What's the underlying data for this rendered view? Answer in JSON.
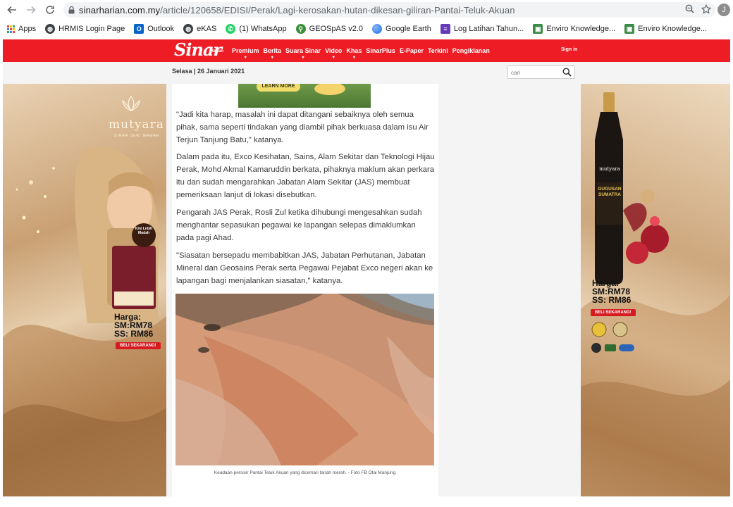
{
  "browser": {
    "url_host": "sinarharian.com.my",
    "url_path": "/article/120658/EDISI/Perak/Lagi-kerosakan-hutan-dikesan-giliran-Pantai-Teluk-Akuan",
    "profile_initial": "J"
  },
  "bookmarks": [
    {
      "label": "Apps",
      "icon": "apps-grid-icon"
    },
    {
      "label": "HRMIS Login Page",
      "icon": "globe-icon"
    },
    {
      "label": "Outlook",
      "icon": "outlook-icon"
    },
    {
      "label": "eKAS",
      "icon": "globe-icon"
    },
    {
      "label": "(1) WhatsApp",
      "icon": "whatsapp-icon"
    },
    {
      "label": "GEOSpAS v2.0",
      "icon": "geospas-icon"
    },
    {
      "label": "Google Earth",
      "icon": "google-earth-icon"
    },
    {
      "label": "Log Latihan Tahun...",
      "icon": "forms-icon"
    },
    {
      "label": "Enviro Knowledge...",
      "icon": "image-icon"
    },
    {
      "label": "Enviro Knowledge...",
      "icon": "image-icon"
    }
  ],
  "site": {
    "logo": "Sinar",
    "logo_sub": "Harian",
    "nav": [
      {
        "label": "Premium",
        "caret": true
      },
      {
        "label": "Berita",
        "caret": true
      },
      {
        "label": "Suara Sinar",
        "caret": true
      },
      {
        "label": "Video",
        "caret": true
      },
      {
        "label": "Khas",
        "caret": true
      },
      {
        "label": "SinarPlus",
        "caret": false
      },
      {
        "label": "E-Paper",
        "caret": false
      },
      {
        "label": "Terkini",
        "caret": false
      },
      {
        "label": "Pengiklanan",
        "caret": false
      }
    ],
    "sign_in": "Sign in",
    "date": "Selasa | 26 Januari 2021",
    "search_placeholder": "cari"
  },
  "ads": {
    "left": {
      "brand": "mutyara",
      "tagline": "SINAR SERI MAWAR",
      "badge": "Kini Lebih Mudah",
      "price_label": "Harga:",
      "price_sm": "SM:RM78",
      "price_ss": "SS: RM86",
      "cta": "BELI SEKARANG!"
    },
    "right": {
      "brand": "mutyara",
      "product": "GUGUSAN SUMATRA",
      "price_label": "Harga:",
      "price_sm": "SM:RM78",
      "price_ss": "SS: RM86",
      "cta": "BELI SEKARANG!"
    },
    "banner_cta": "LEARN MORE"
  },
  "article": {
    "paragraphs": [
      "\"Jadi kita harap, masalah ini dapat ditangani sebaiknya oleh semua pihak, sama seperti tindakan yang diambil pihak berkuasa dalam isu Air Terjun Tanjung Batu,\" katanya.",
      "Dalam pada itu, Exco Kesihatan, Sains, Alam Sekitar dan Teknologi Hijau Perak, Mohd Akmal Kamaruddin berkata, pihaknya maklum akan perkara itu dan sudah mengarahkan Jabatan Alam Sekitar (JAS) membuat pemeriksaan lanjut di lokasi disebutkan.",
      "Pengarah JAS Perak, Rosli Zul ketika dihubungi mengesahkan sudah menghantar sepasukan pegawai ke lapangan selepas dimaklumkan pada pagi Ahad.",
      "\"Siasatan bersepadu membabitkan JAS, Jabatan Perhutanan, Jabatan Mineral dan Geosains Perak serta Pegawai Pejabat Exco negeri akan ke lapangan bagi menjalankan siasatan,\" katanya."
    ],
    "caption": "Keadaan persisir Pantai Teluk Akuan yang dicemari tanah merah. - Foto FB Otai Manjung"
  }
}
